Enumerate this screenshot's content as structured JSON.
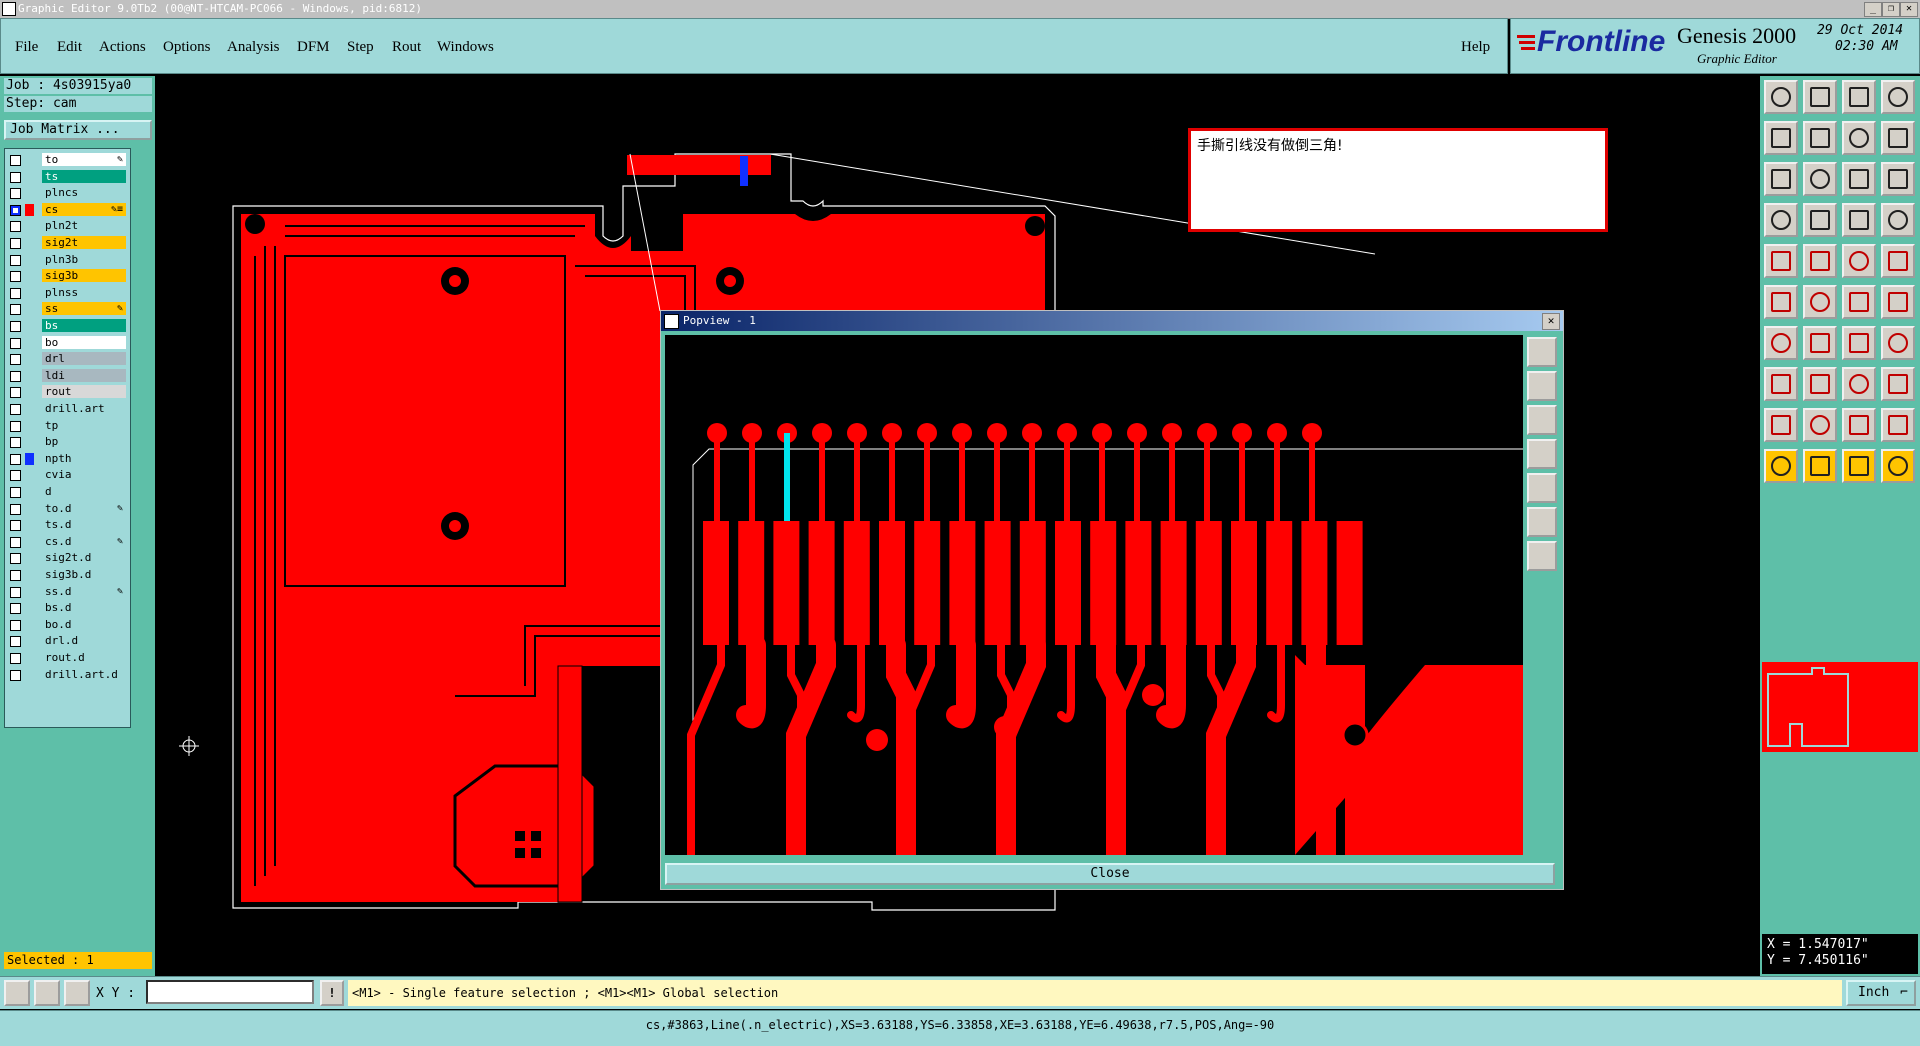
{
  "window": {
    "title": "Graphic Editor 9.0Tb2 (00@NT-HTCAM-PC066 - Windows, pid:6812)"
  },
  "menu": {
    "items": [
      "File",
      "Edit",
      "Actions",
      "Options",
      "Analysis",
      "DFM",
      "Step",
      "Rout",
      "Windows"
    ],
    "help": "Help"
  },
  "brand": {
    "company": "Frontline",
    "product": "Genesis 2000",
    "subtitle": "Graphic Editor",
    "date": "29 Oct 2014",
    "time": "02:30 AM"
  },
  "job": {
    "job_label": "Job : 4s03915ya0",
    "step_label": "Step: cam",
    "job_matrix_button": "Job Matrix ..."
  },
  "layers": [
    {
      "name": "to",
      "color": "#ffffff",
      "mark": "✎"
    },
    {
      "name": "ts",
      "color": "#00a080",
      "dark": true,
      "mark": ""
    },
    {
      "name": "plncs",
      "color": "#9fd9d9",
      "mark": ""
    },
    {
      "name": "cs",
      "color": "#ffc400",
      "selected": true,
      "mark": "✎≡"
    },
    {
      "name": "pln2t",
      "color": "#9fd9d9",
      "mark": ""
    },
    {
      "name": "sig2t",
      "color": "#ffc400",
      "mark": ""
    },
    {
      "name": "pln3b",
      "color": "#9fd9d9",
      "mark": ""
    },
    {
      "name": "sig3b",
      "color": "#ffc400",
      "mark": ""
    },
    {
      "name": "plnss",
      "color": "#9fd9d9",
      "mark": ""
    },
    {
      "name": "ss",
      "color": "#ffc400",
      "mark": "✎"
    },
    {
      "name": "bs",
      "color": "#00a080",
      "dark": true,
      "mark": ""
    },
    {
      "name": "bo",
      "color": "#ffffff",
      "mark": ""
    },
    {
      "name": "drl",
      "color": "#a8b8c0",
      "mark": ""
    },
    {
      "name": "ldi",
      "color": "#a8b8c0",
      "mark": ""
    },
    {
      "name": "rout",
      "color": "#d8d8d8",
      "mark": ""
    },
    {
      "name": "drill.art",
      "color": "#9fd9d9",
      "mark": ""
    },
    {
      "name": "tp",
      "color": "#9fd9d9",
      "mark": ""
    },
    {
      "name": "bp",
      "color": "#9fd9d9",
      "mark": ""
    },
    {
      "name": "npth",
      "color": "#9fd9d9",
      "mark": "",
      "swatch": "#1030ff"
    },
    {
      "name": "cvia",
      "color": "#9fd9d9",
      "mark": ""
    },
    {
      "name": "d",
      "color": "#9fd9d9",
      "mark": ""
    },
    {
      "name": "to.d",
      "color": "#9fd9d9",
      "mark": "✎"
    },
    {
      "name": "ts.d",
      "color": "#9fd9d9",
      "mark": ""
    },
    {
      "name": "cs.d",
      "color": "#9fd9d9",
      "mark": "✎"
    },
    {
      "name": "sig2t.d",
      "color": "#9fd9d9",
      "mark": ""
    },
    {
      "name": "sig3b.d",
      "color": "#9fd9d9",
      "mark": ""
    },
    {
      "name": "ss.d",
      "color": "#9fd9d9",
      "mark": "✎"
    },
    {
      "name": "bs.d",
      "color": "#9fd9d9",
      "mark": ""
    },
    {
      "name": "bo.d",
      "color": "#9fd9d9",
      "mark": ""
    },
    {
      "name": "drl.d",
      "color": "#9fd9d9",
      "mark": ""
    },
    {
      "name": "rout.d",
      "color": "#9fd9d9",
      "mark": ""
    },
    {
      "name": "drill.art.d",
      "color": "#9fd9d9",
      "mark": ""
    }
  ],
  "selection": {
    "label": "Selected : 1"
  },
  "note": {
    "text": "手撕引线没有做倒三角!"
  },
  "popview": {
    "title": "Popview - 1",
    "close_label": "Close"
  },
  "coords": {
    "x": "X = 1.547017\"",
    "y": "Y = 7.450116\""
  },
  "bottom": {
    "xy_label": "X Y :",
    "hint": "<M1> - Single feature selection ; <M1><M1> Global selection",
    "units": "Inch"
  },
  "status": {
    "text": "cs,#3863,Line(.n_electric),XS=3.63188,YS=6.33858,XE=3.63188,YE=6.49638,r7.5,POS,Ang=-90"
  },
  "colors": {
    "copper": "#ff0000",
    "panel": "#9fd9d9",
    "highlight": "#00e5ee",
    "accent": "#ffc400"
  }
}
